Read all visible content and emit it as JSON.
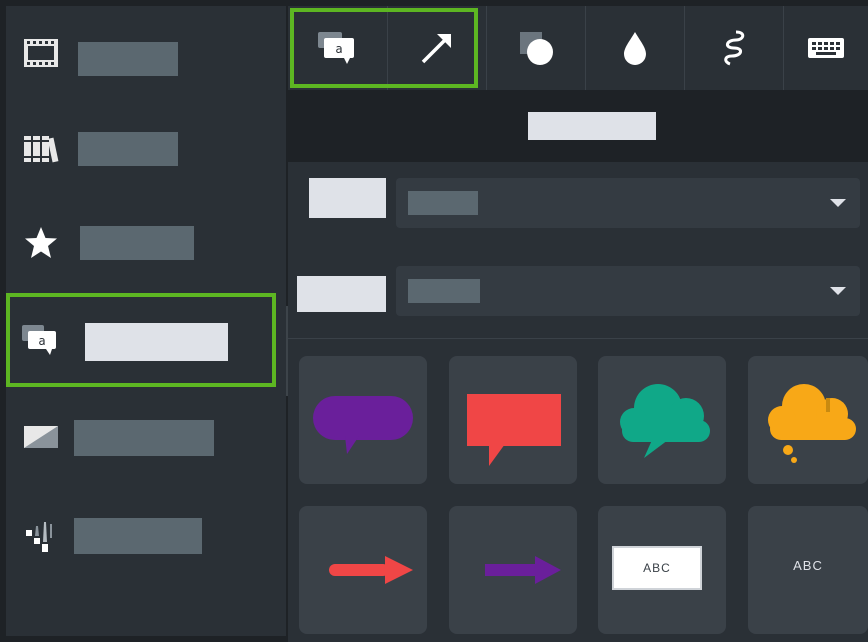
{
  "sidebar": {
    "items": [
      {
        "icon": "film-strip-icon",
        "label": ""
      },
      {
        "icon": "library-books-icon",
        "label": ""
      },
      {
        "icon": "star-icon",
        "label": ""
      },
      {
        "icon": "annotation-callout-icon",
        "label": "",
        "selected": true
      },
      {
        "icon": "transition-icon",
        "label": ""
      },
      {
        "icon": "behaviors-icon",
        "label": ""
      }
    ]
  },
  "toolbar": {
    "tabs": [
      {
        "icon": "callout-tab-icon",
        "label": ""
      },
      {
        "icon": "arrow-tab-icon",
        "label": ""
      },
      {
        "icon": "shape-tab-icon",
        "label": ""
      },
      {
        "icon": "blur-drop-icon",
        "label": ""
      },
      {
        "icon": "sketch-motion-icon",
        "label": ""
      },
      {
        "icon": "keyboard-icon",
        "label": ""
      }
    ]
  },
  "header": {
    "title": ""
  },
  "properties": {
    "style": {
      "label": "",
      "value": ""
    },
    "theme": {
      "label": "",
      "value": ""
    }
  },
  "gallery": {
    "abc_boxed": "ABC",
    "abc_plain": "ABC"
  },
  "colors": {
    "highlight": "#5db622",
    "purple": "#6a1f9b",
    "red": "#f04646",
    "teal": "#10a888",
    "orange": "#f8a817"
  }
}
